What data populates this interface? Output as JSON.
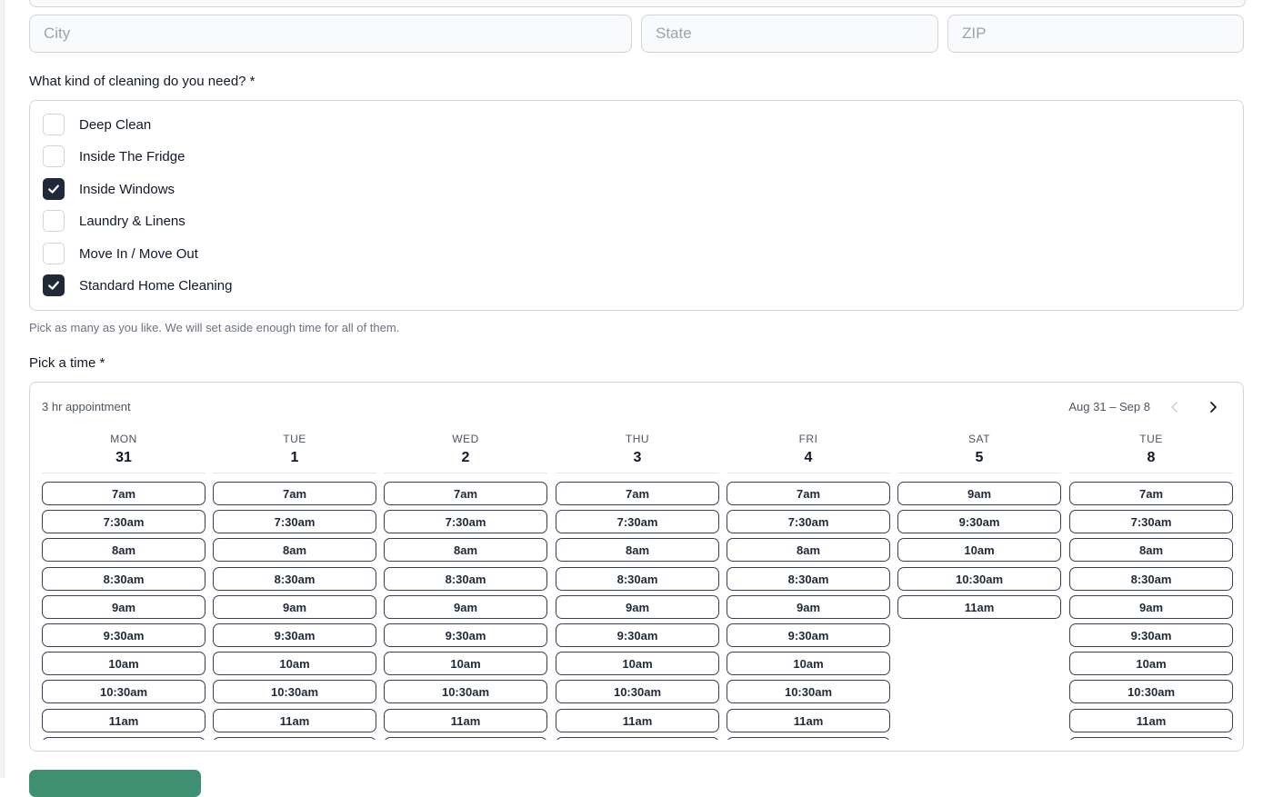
{
  "address": {
    "city_placeholder": "City",
    "state_placeholder": "State",
    "zip_placeholder": "ZIP"
  },
  "cleaning": {
    "question": "What kind of cleaning do you need? *",
    "options": [
      {
        "label": "Deep Clean",
        "checked": false
      },
      {
        "label": "Inside The Fridge",
        "checked": false
      },
      {
        "label": "Inside Windows",
        "checked": true
      },
      {
        "label": "Laundry & Linens",
        "checked": false
      },
      {
        "label": "Move In / Move Out",
        "checked": false
      },
      {
        "label": "Standard Home Cleaning",
        "checked": true
      }
    ],
    "hint": "Pick as many as you like. We will set aside enough time for all of them."
  },
  "schedule": {
    "label": "Pick a time *",
    "duration": "3 hr appointment",
    "range": "Aug 31 – Sep 8",
    "days": [
      {
        "dow": "MON",
        "date": "31",
        "slots": [
          "7am",
          "7:30am",
          "8am",
          "8:30am",
          "9am",
          "9:30am",
          "10am",
          "10:30am",
          "11am",
          ""
        ]
      },
      {
        "dow": "TUE",
        "date": "1",
        "slots": [
          "7am",
          "7:30am",
          "8am",
          "8:30am",
          "9am",
          "9:30am",
          "10am",
          "10:30am",
          "11am",
          ""
        ]
      },
      {
        "dow": "WED",
        "date": "2",
        "slots": [
          "7am",
          "7:30am",
          "8am",
          "8:30am",
          "9am",
          "9:30am",
          "10am",
          "10:30am",
          "11am",
          ""
        ]
      },
      {
        "dow": "THU",
        "date": "3",
        "slots": [
          "7am",
          "7:30am",
          "8am",
          "8:30am",
          "9am",
          "9:30am",
          "10am",
          "10:30am",
          "11am",
          ""
        ]
      },
      {
        "dow": "FRI",
        "date": "4",
        "slots": [
          "7am",
          "7:30am",
          "8am",
          "8:30am",
          "9am",
          "9:30am",
          "10am",
          "10:30am",
          "11am",
          ""
        ]
      },
      {
        "dow": "SAT",
        "date": "5",
        "slots": [
          "9am",
          "9:30am",
          "10am",
          "10:30am",
          "11am"
        ]
      },
      {
        "dow": "TUE",
        "date": "8",
        "slots": [
          "7am",
          "7:30am",
          "8am",
          "8:30am",
          "9am",
          "9:30am",
          "10am",
          "10:30am",
          "11am",
          ""
        ]
      }
    ]
  },
  "colors": {
    "checkbox_checked": "#1f2937",
    "submit": "#3f8f72",
    "border": "#d1d5db"
  }
}
